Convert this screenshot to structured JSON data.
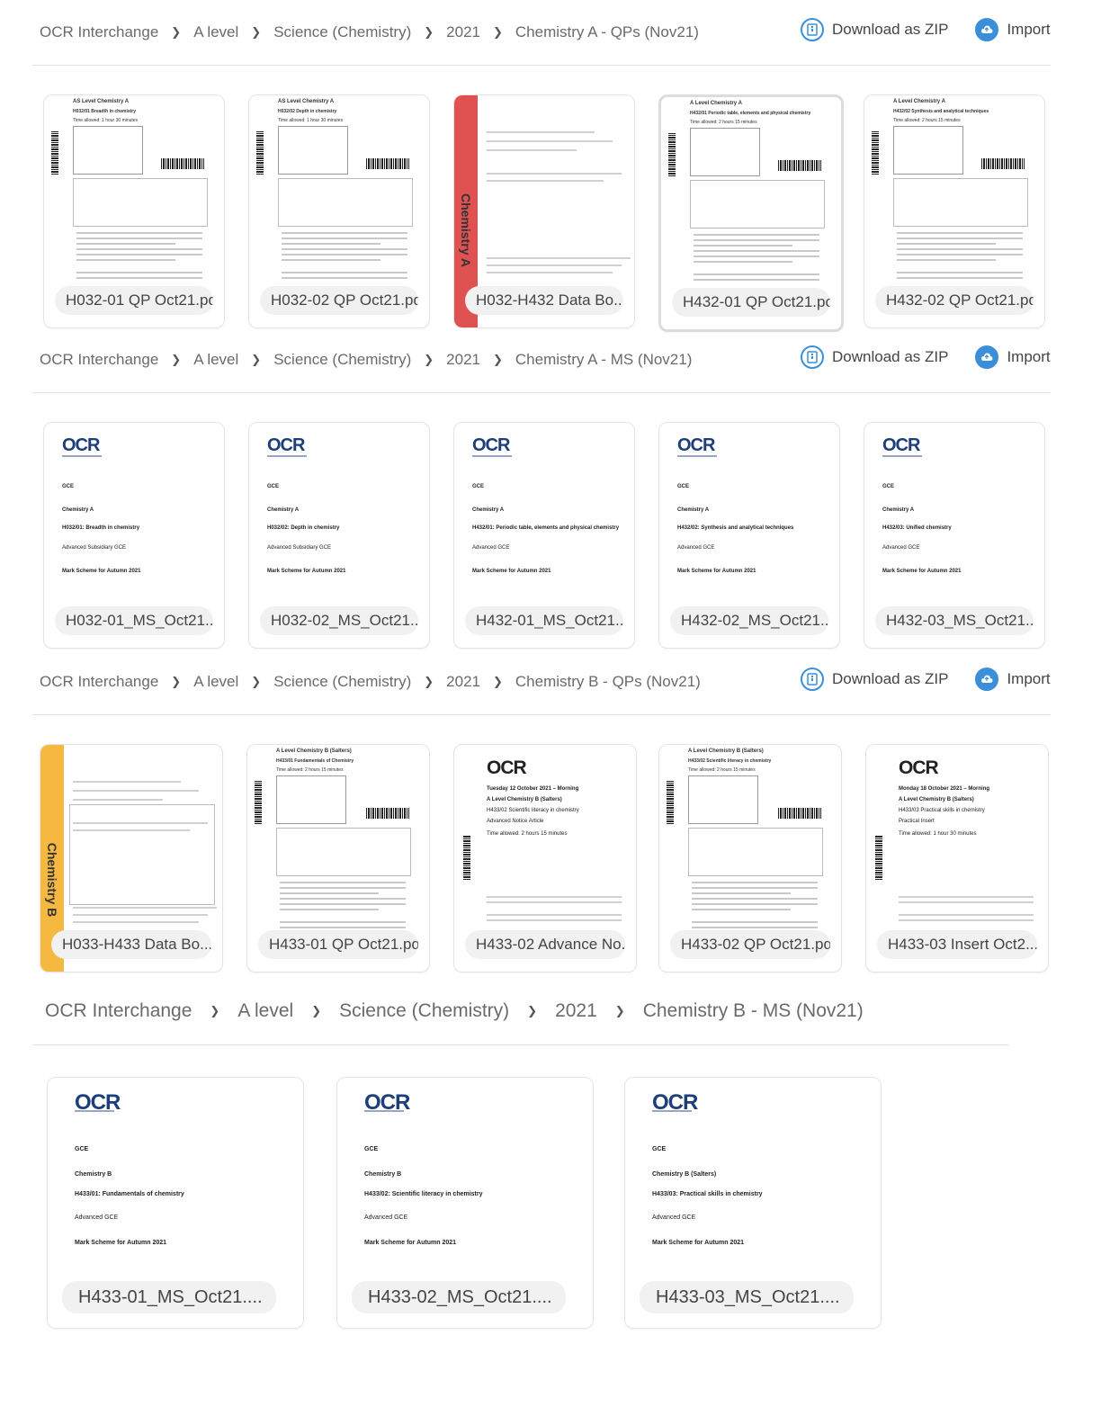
{
  "sections": [
    {
      "breadcrumb": [
        "OCR Interchange",
        "A level",
        "Science (Chemistry)",
        "2021",
        "Chemistry A - QPs (Nov21)"
      ],
      "actions": {
        "download": "Download as ZIP",
        "import": "Import to r"
      },
      "files": [
        {
          "name": "H032-01 QP Oct21.pdf",
          "kind": "qp",
          "h1": "AS Level Chemistry A",
          "h2": "H032/01 Breadth in chemistry",
          "h3": "Time allowed: 1 hour 30 minutes"
        },
        {
          "name": "H032-02 QP Oct21.pdf",
          "kind": "qp",
          "h1": "AS Level Chemistry A",
          "h2": "H032/02 Depth in chemistry",
          "h3": "Time allowed: 1 hour 30 minutes"
        },
        {
          "name": "H032-H432 Data Bo...",
          "kind": "data",
          "strip": "Chemistry A",
          "strip_color": "#e05252"
        },
        {
          "name": "H432-01 QP Oct21.pc",
          "kind": "qp",
          "h1": "A Level Chemistry A",
          "h2": "H432/01 Periodic table, elements and physical chemistry",
          "h3": "Time allowed: 2 hours 15 minutes",
          "more": "•••",
          "highlight": true
        },
        {
          "name": "H432-02 QP Oct21.pdf",
          "kind": "qp",
          "h1": "A Level Chemistry A",
          "h2": "H432/02 Synthesis and analytical techniques",
          "h3": "Time allowed: 2 hours 15 minutes"
        }
      ]
    },
    {
      "breadcrumb": [
        "OCR Interchange",
        "A level",
        "Science (Chemistry)",
        "2021",
        "Chemistry A - MS (Nov21)"
      ],
      "actions": {
        "download": "Download as ZIP",
        "import": "Import to r"
      },
      "files": [
        {
          "name": "H032-01_MS_Oct21....",
          "kind": "ms",
          "logo": "OCR",
          "l1": "GCE",
          "l2": "Chemistry A",
          "l3": "H032/01: Breadth in chemistry",
          "l4": "Advanced Subsidiary GCE",
          "l5": "Mark Scheme for Autumn 2021"
        },
        {
          "name": "H032-02_MS_Oct21....",
          "kind": "ms",
          "logo": "OCR",
          "l1": "GCE",
          "l2": "Chemistry A",
          "l3": "H032/02: Depth in chemistry",
          "l4": "Advanced Subsidiary GCE",
          "l5": "Mark Scheme for Autumn 2021"
        },
        {
          "name": "H432-01_MS_Oct21....",
          "kind": "ms",
          "logo": "OCR",
          "l1": "GCE",
          "l2": "Chemistry A",
          "l3": "H432/01: Periodic table, elements and physical chemistry",
          "l4": "Advanced GCE",
          "l5": "Mark Scheme for Autumn 2021"
        },
        {
          "name": "H432-02_MS_Oct21....",
          "kind": "ms",
          "logo": "OCR",
          "l1": "GCE",
          "l2": "Chemistry A",
          "l3": "H432/02: Synthesis and analytical techniques",
          "l4": "Advanced GCE",
          "l5": "Mark Scheme for Autumn 2021"
        },
        {
          "name": "H432-03_MS_Oct21....",
          "kind": "ms",
          "logo": "OCR",
          "l1": "GCE",
          "l2": "Chemistry A",
          "l3": "H432/03: Unified chemistry",
          "l4": "Advanced GCE",
          "l5": "Mark Scheme for Autumn 2021"
        }
      ]
    },
    {
      "breadcrumb": [
        "OCR Interchange",
        "A level",
        "Science (Chemistry)",
        "2021",
        "Chemistry B - QPs (Nov21)"
      ],
      "actions": {
        "download": "Download as ZIP",
        "import": "Import to"
      },
      "files": [
        {
          "name": "H033-H433 Data Bo...",
          "kind": "data",
          "strip": "Chemistry B",
          "strip_color": "#f5b942"
        },
        {
          "name": "H433-01 QP Oct21.pdf",
          "kind": "qp",
          "h1": "A Level Chemistry B (Salters)",
          "h2": "H433/01 Fundamentals of Chemistry",
          "h3": "Time allowed: 2 hours 15 minutes"
        },
        {
          "name": "H433-02 Advance No...",
          "kind": "ocr2",
          "logo": "OCR",
          "l1": "Tuesday 12 October 2021 – Morning",
          "l2": "A Level Chemistry B (Salters)",
          "l3": "H433/02 Scientific literacy in chemistry",
          "l4": "Advanced Notice Article",
          "l5": "Time allowed: 2 hours 15 minutes"
        },
        {
          "name": "H433-02 QP Oct21.pdf",
          "kind": "qp",
          "h1": "A Level Chemistry B (Salters)",
          "h2": "H433/02 Scientific literacy in chemistry",
          "h3": "Time allowed: 2 hours 15 minutes"
        },
        {
          "name": "H433-03 Insert Oct2...",
          "kind": "ocr2",
          "logo": "OCR",
          "l1": "Monday 18 October 2021 – Morning",
          "l2": "A Level Chemistry B (Salters)",
          "l3": "H433/03 Practical skills in chemistry",
          "l4": "Practical Insert",
          "l5": "Time allowed: 1 hour 30 minutes"
        }
      ]
    },
    {
      "breadcrumb": [
        "OCR Interchange",
        "A level",
        "Science (Chemistry)",
        "2021",
        "Chemistry B - MS (Nov21)"
      ],
      "files": [
        {
          "name": "H433-01_MS_Oct21....",
          "kind": "ms",
          "logo": "OCR",
          "l1": "GCE",
          "l2": "Chemistry B",
          "l3": "H433/01: Fundamentals of chemistry",
          "l4": "Advanced GCE",
          "l5": "Mark Scheme for Autumn 2021"
        },
        {
          "name": "H433-02_MS_Oct21....",
          "kind": "ms",
          "logo": "OCR",
          "l1": "GCE",
          "l2": "Chemistry B",
          "l3": "H433/02: Scientific literacy in chemistry",
          "l4": "Advanced GCE",
          "l5": "Mark Scheme for Autumn 2021"
        },
        {
          "name": "H433-03_MS_Oct21....",
          "kind": "ms",
          "logo": "OCR",
          "l1": "GCE",
          "l2": "Chemistry B (Salters)",
          "l3": "H433/03: Practical skills in chemistry",
          "l4": "Advanced GCE",
          "l5": "Mark Scheme for Autumn 2021"
        }
      ]
    }
  ],
  "icons": {
    "download": "zip-file-icon",
    "import": "cloud-upload-icon",
    "more": "more-dots-icon"
  },
  "colors": {
    "accent": "#3b8fd8",
    "ocr_blue": "#1d3e7a"
  }
}
